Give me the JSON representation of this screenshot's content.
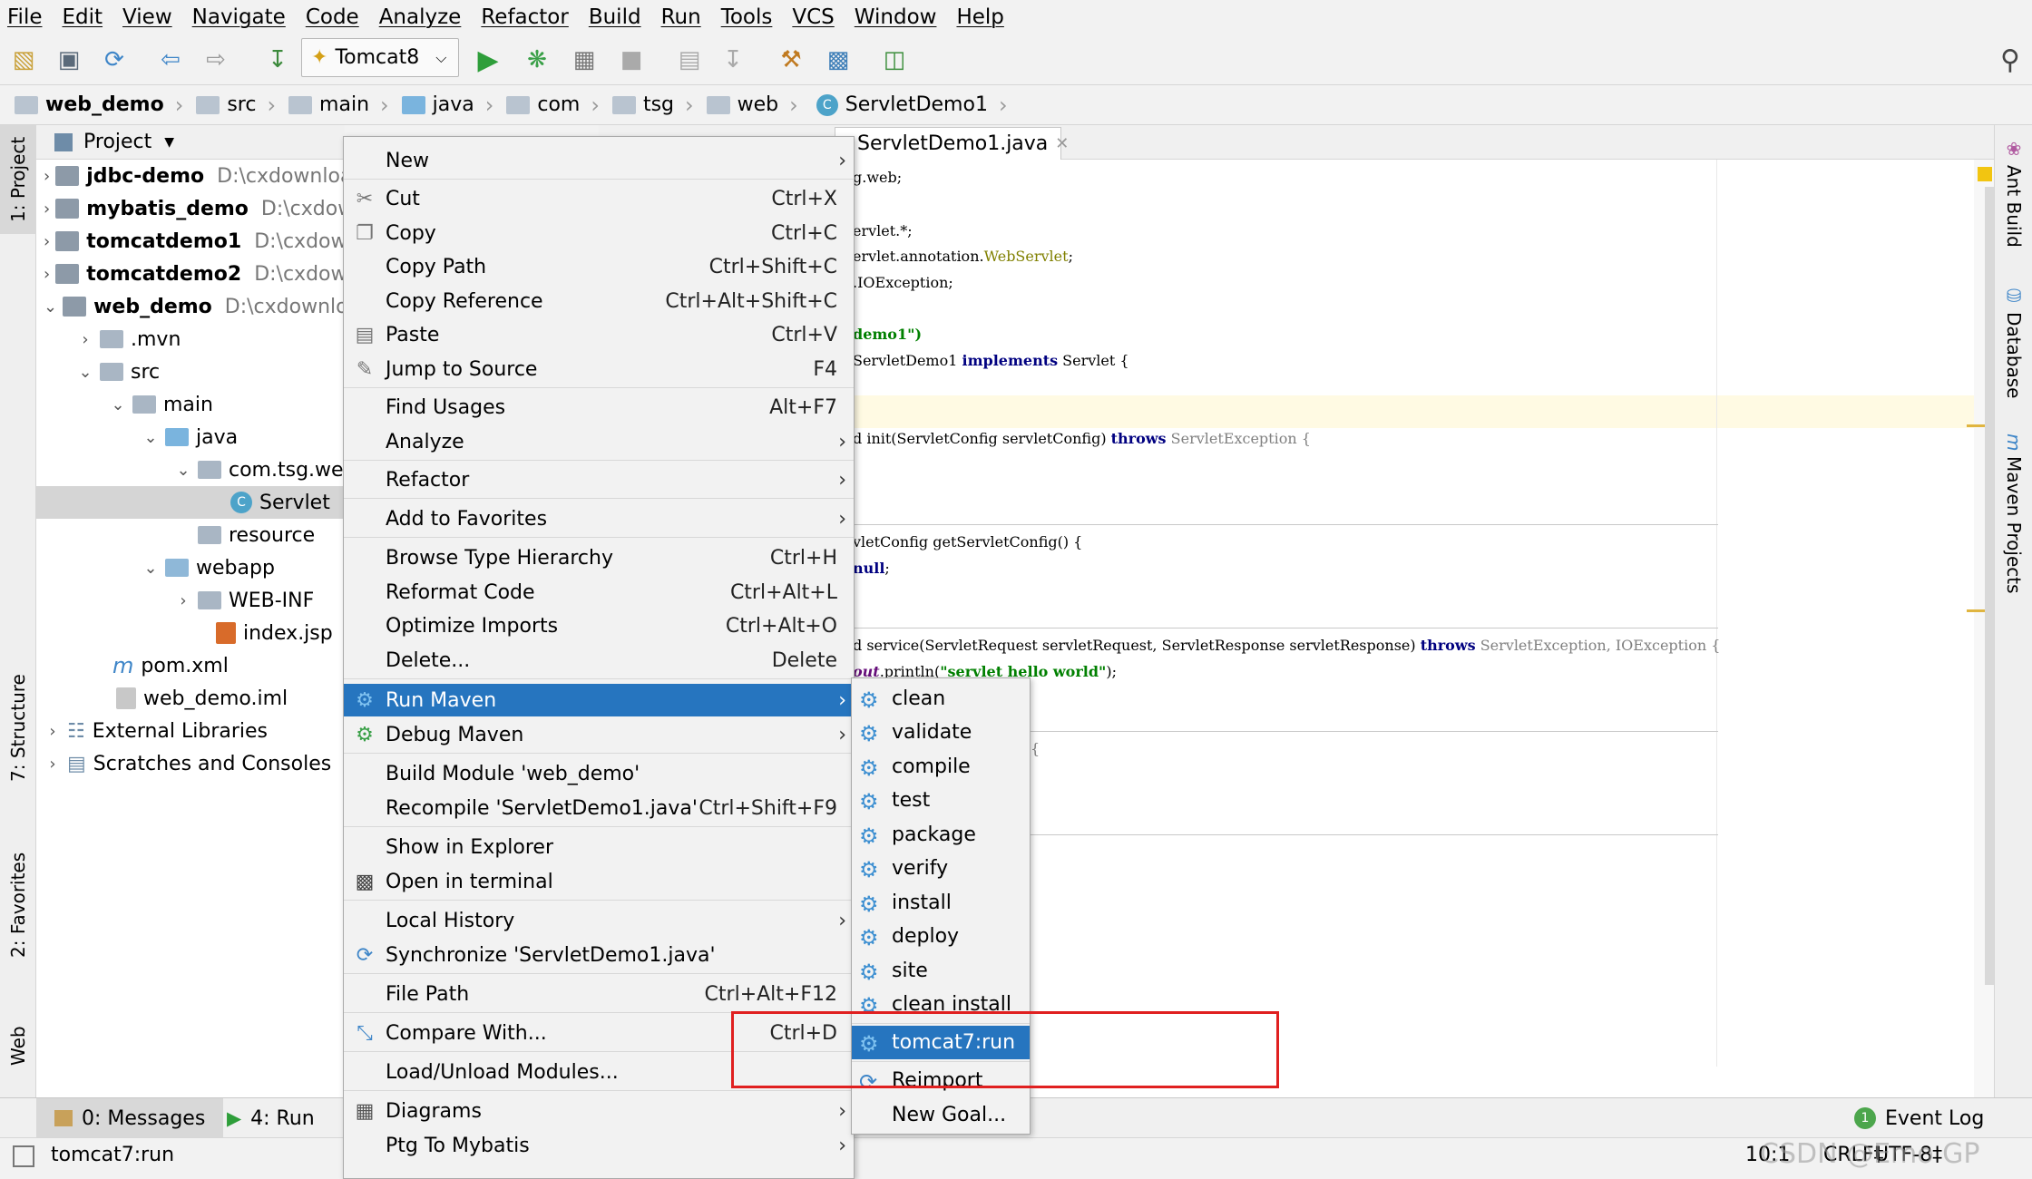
{
  "menubar": [
    "File",
    "Edit",
    "View",
    "Navigate",
    "Code",
    "Analyze",
    "Refactor",
    "Build",
    "Run",
    "Tools",
    "VCS",
    "Window",
    "Help"
  ],
  "toolbar": {
    "run_config": "Tomcat8"
  },
  "breadcrumb": [
    "web_demo",
    "src",
    "main",
    "java",
    "com",
    "tsg",
    "web",
    "ServletDemo1"
  ],
  "left_tabs": {
    "project": "1: Project",
    "structure": "7: Structure",
    "favorites": "2: Favorites",
    "web": "Web"
  },
  "right_tabs": {
    "ant": "Ant Build",
    "database": "Database",
    "maven": "Maven Projects"
  },
  "project_panel": {
    "title": "Project",
    "tree": [
      {
        "name": "jdbc-demo",
        "path": "D:\\cxdownloa"
      },
      {
        "name": "mybatis_demo",
        "path": "D:\\cxdow"
      },
      {
        "name": "tomcatdemo1",
        "path": "D:\\cxdowi"
      },
      {
        "name": "tomcatdemo2",
        "path": "D:\\cxdowi"
      },
      {
        "name": "web_demo",
        "path": "D:\\cxdownloa"
      },
      {
        "name": ".mvn"
      },
      {
        "name": "src"
      },
      {
        "name": "main"
      },
      {
        "name": "java"
      },
      {
        "name": "com.tsg.we"
      },
      {
        "name": "Servlet"
      },
      {
        "name": "resource"
      },
      {
        "name": "webapp"
      },
      {
        "name": "WEB-INF"
      },
      {
        "name": "index.jsp"
      },
      {
        "name": "pom.xml"
      },
      {
        "name": "web_demo.iml"
      },
      {
        "name": "External Libraries"
      },
      {
        "name": "Scratches and Consoles"
      }
    ]
  },
  "editor": {
    "tab": "ServletDemo1.java",
    "lines": {
      "l1": "g.web;",
      "l2": "ervlet.*;",
      "l3a": "ervlet.annotation.",
      "l3b": "WebServlet",
      "l3c": ";",
      "l4": ".IOException;",
      "l5": "demo1\")",
      "l6a": "ServletDemo1 ",
      "l6b": "implements",
      "l6c": " Servlet {",
      "l7a": "d init(ServletConfig servletConfig) ",
      "l7b": "throws",
      "l7c": " ServletException {",
      "l8": "vletConfig getServletConfig() {",
      "l9": "null",
      "l9b": ";",
      "l10a": "d service(ServletRequest servletRequest, ServletResponse servletResponse) ",
      "l10b": "throws",
      "l10c": " ServletException, IOException {",
      "l11a": "out",
      "l11b": ".println(",
      "l11c": "\"servlet hello world\"",
      "l11d": ");",
      "l12": "{",
      "l13": "s"
    }
  },
  "context_menu": {
    "items": [
      {
        "label": "New",
        "submenu": true
      },
      {
        "label": "Cut",
        "shortcut": "Ctrl+X"
      },
      {
        "label": "Copy",
        "shortcut": "Ctrl+C"
      },
      {
        "label": "Copy Path",
        "shortcut": "Ctrl+Shift+C"
      },
      {
        "label": "Copy Reference",
        "shortcut": "Ctrl+Alt+Shift+C"
      },
      {
        "label": "Paste",
        "shortcut": "Ctrl+V"
      },
      {
        "label": "Jump to Source",
        "shortcut": "F4"
      },
      {
        "label": "Find Usages",
        "shortcut": "Alt+F7"
      },
      {
        "label": "Analyze",
        "submenu": true
      },
      {
        "label": "Refactor",
        "submenu": true
      },
      {
        "label": "Add to Favorites",
        "submenu": true
      },
      {
        "label": "Browse Type Hierarchy",
        "shortcut": "Ctrl+H"
      },
      {
        "label": "Reformat Code",
        "shortcut": "Ctrl+Alt+L"
      },
      {
        "label": "Optimize Imports",
        "shortcut": "Ctrl+Alt+O"
      },
      {
        "label": "Delete...",
        "shortcut": "Delete"
      },
      {
        "label": "Run Maven",
        "submenu": true
      },
      {
        "label": "Debug Maven",
        "submenu": true
      },
      {
        "label": "Build Module 'web_demo'"
      },
      {
        "label": "Recompile 'ServletDemo1.java'",
        "shortcut": "Ctrl+Shift+F9"
      },
      {
        "label": "Show in Explorer"
      },
      {
        "label": "Open in terminal"
      },
      {
        "label": "Local History",
        "submenu": true
      },
      {
        "label": "Synchronize 'ServletDemo1.java'"
      },
      {
        "label": "File Path",
        "shortcut": "Ctrl+Alt+F12"
      },
      {
        "label": "Compare With...",
        "shortcut": "Ctrl+D"
      },
      {
        "label": "Load/Unload Modules..."
      },
      {
        "label": "Diagrams",
        "submenu": true
      },
      {
        "label": "Ptg To Mybatis",
        "submenu": true
      }
    ]
  },
  "run_maven_submenu": [
    "clean",
    "validate",
    "compile",
    "test",
    "package",
    "verify",
    "install",
    "deploy",
    "site",
    "clean install",
    "tomcat7:run",
    "Reimport",
    "New Goal..."
  ],
  "bottom_tabs": {
    "messages": "0: Messages",
    "run": "4: Run",
    "event_log": "Event Log",
    "event_count": "1"
  },
  "status": {
    "message": "tomcat7:run",
    "position": "10:1",
    "line_sep": "CRLF‡",
    "encoding": "UTF-8‡",
    "watermark": "CSDN @Emo GP"
  }
}
